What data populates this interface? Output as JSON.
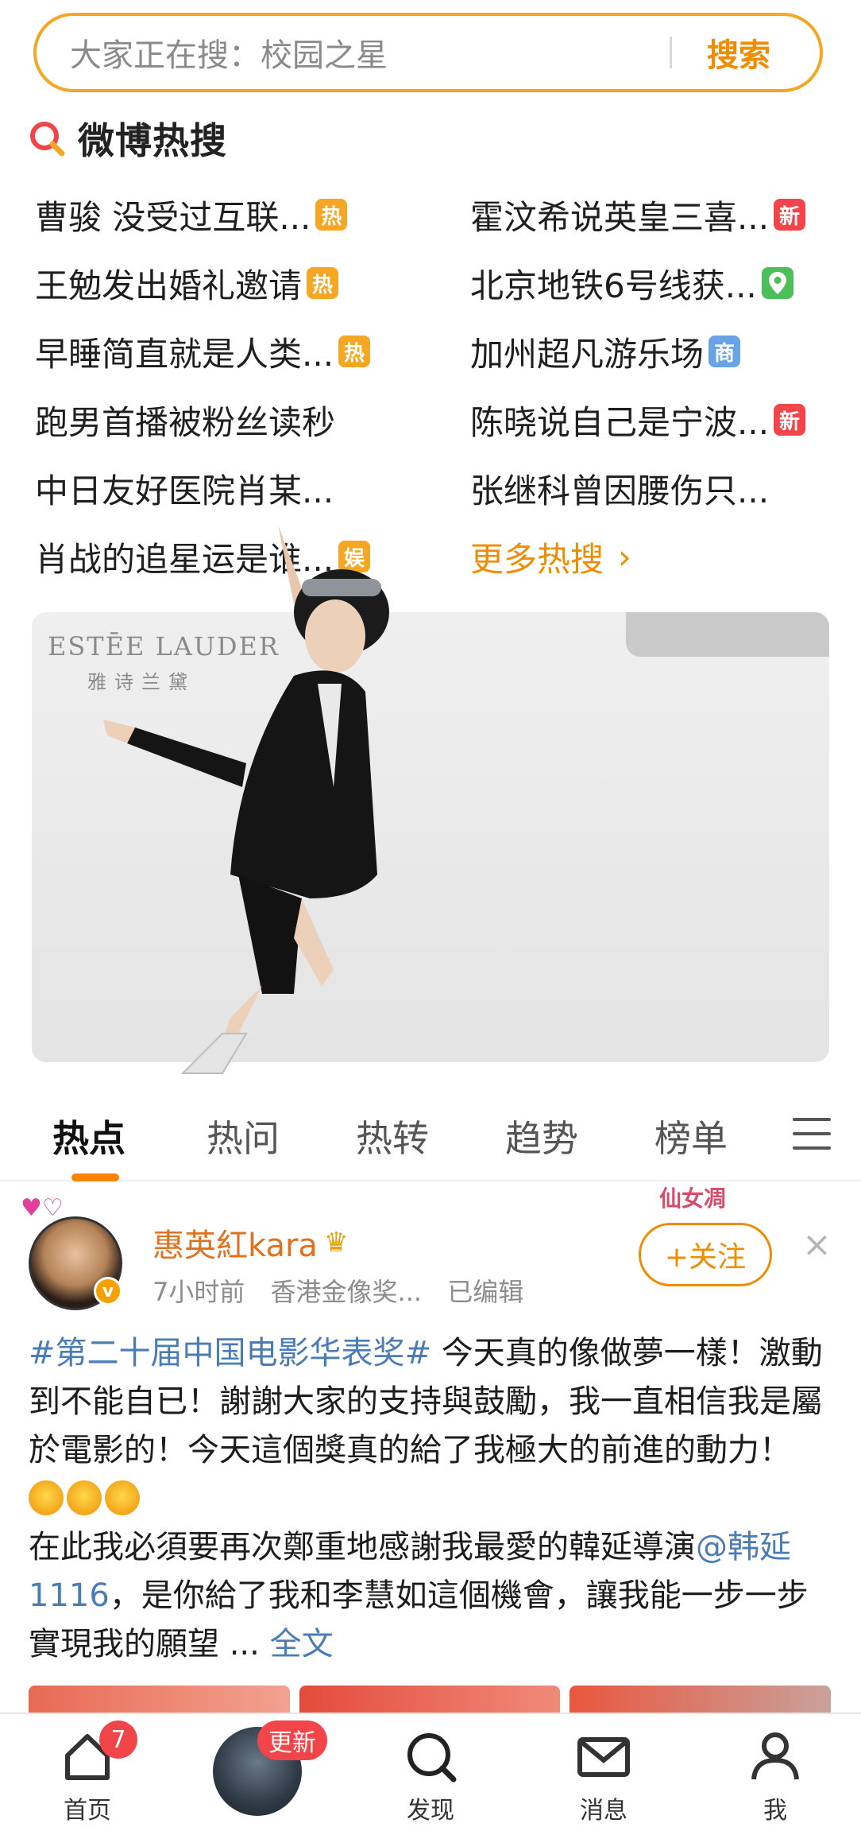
{
  "search": {
    "placeholder": "大家正在搜：校园之星",
    "button_label": "搜索"
  },
  "hot_header": {
    "title": "微博热搜"
  },
  "hot_items": [
    {
      "text": "曹骏 没受过互联...",
      "badge": "热",
      "badge_color": "#f5a623"
    },
    {
      "text": "霍汶希说英皇三喜...",
      "badge": "新",
      "badge_color": "#f2454a"
    },
    {
      "text": "王勉发出婚礼邀请",
      "badge": "热",
      "badge_color": "#f5a623"
    },
    {
      "text": "北京地铁6号线获...",
      "badge": "",
      "badge_color": "#4cbf5a",
      "badge_icon": "location-icon"
    },
    {
      "text": "早睡简直就是人类...",
      "badge": "热",
      "badge_color": "#f5a623"
    },
    {
      "text": "加州超凡游乐场",
      "badge": "商",
      "badge_color": "#6aa2e8"
    },
    {
      "text": "跑男首播被粉丝读秒",
      "badge": "",
      "badge_color": ""
    },
    {
      "text": "陈晓说自己是宁波...",
      "badge": "新",
      "badge_color": "#f2454a"
    },
    {
      "text": "中日友好医院肖某...",
      "badge": "",
      "badge_color": ""
    },
    {
      "text": "张继科曾因腰伤只...",
      "badge": "",
      "badge_color": ""
    },
    {
      "text": "肖战的追星运是谁...",
      "badge": "娱",
      "badge_color": "#f5a623"
    }
  ],
  "more_hot": {
    "label": "更多热搜",
    "chevron": "›"
  },
  "banner": {
    "brand_en": "ESTĒE LAUDER",
    "brand_cn": "雅诗兰黛"
  },
  "tabs": [
    {
      "label": "热点",
      "active": true
    },
    {
      "label": "热问",
      "active": false
    },
    {
      "label": "热转",
      "active": false
    },
    {
      "label": "趋势",
      "active": false
    },
    {
      "label": "榜单",
      "active": false
    }
  ],
  "post": {
    "username": "惠英紅kara",
    "time": "7小时前",
    "source": "香港金像奖...",
    "edited": "已编辑",
    "follow_label": "+关注",
    "follow_deco": "仙女凋",
    "close": "×",
    "hashtag": "#第二十届中国电影华表奖#",
    "text_1": " 今天真的像做夢一樣！激動到不能自已！謝謝大家的支持與鼓勵，我一直相信我是屬於電影的！今天這個獎真的給了我極大的前進的動力！",
    "text_2": "在此我必須要再次鄭重地感謝我最愛的韓延導演",
    "mention": "@韩延1116",
    "text_3": "，是你給了我和李慧如這個機會，讓我能一步一步實現我的願望 ... ",
    "full_text": "全文"
  },
  "bottom_nav": {
    "home_label": "首页",
    "home_badge": "7",
    "story_badge": "更新",
    "discover_label": "发现",
    "messages_label": "消息",
    "me_label": "我"
  },
  "colors": {
    "accent": "#f08c00",
    "link": "#4b7db5",
    "badge_red": "#f2454a"
  }
}
